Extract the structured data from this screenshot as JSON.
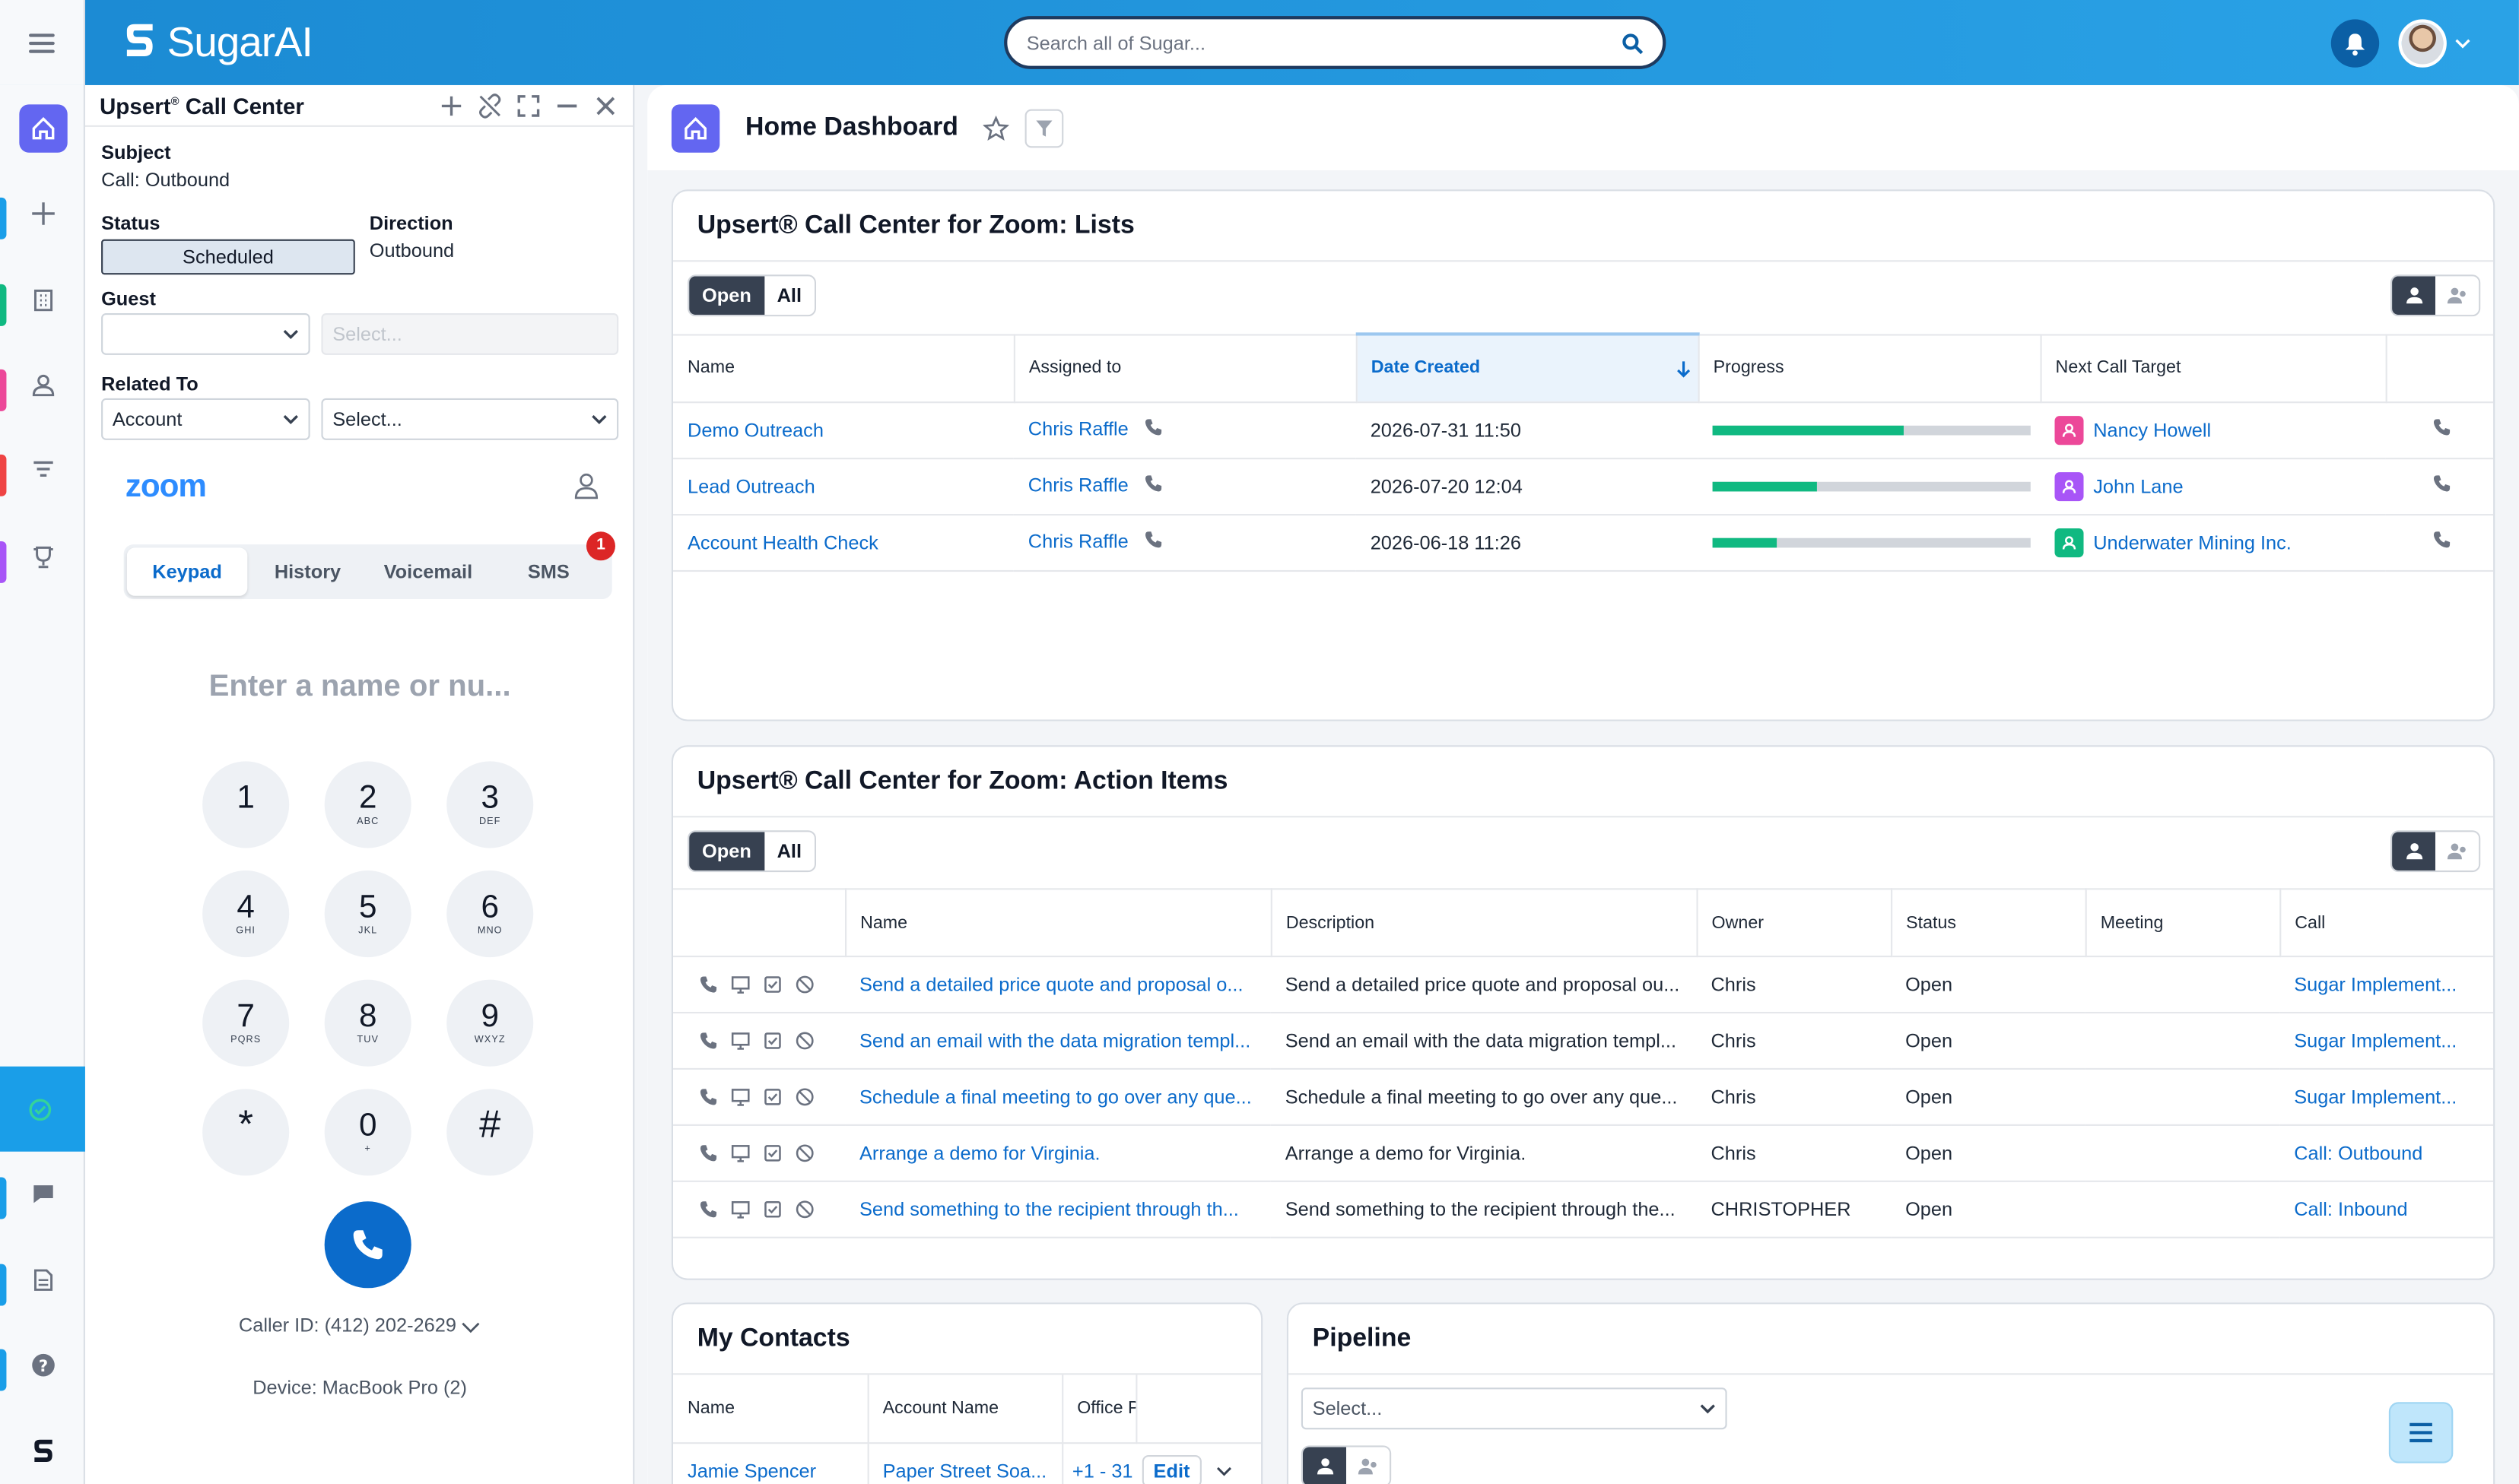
{
  "app": {
    "name": "SugarAI"
  },
  "search": {
    "placeholder": "Search all of Sugar..."
  },
  "call_center": {
    "title": "Upsert",
    "title_sup": "®",
    "title_rest": " Call Center",
    "subject_label": "Subject",
    "subject_value": "Call: Outbound",
    "status_label": "Status",
    "status_value": "Scheduled",
    "direction_label": "Direction",
    "direction_value": "Outbound",
    "guest_label": "Guest",
    "guest_value": "",
    "guest_placeholder": "Select...",
    "related_label": "Related To",
    "related_value": "Account",
    "related_placeholder": "Select...",
    "zoom_logo": "zoom",
    "tabs": [
      "Keypad",
      "History",
      "Voicemail",
      "SMS"
    ],
    "sms_badge": "1",
    "dial_placeholder": "Enter a name or nu...",
    "keys": [
      {
        "d": "1",
        "l": ""
      },
      {
        "d": "2",
        "l": "ABC"
      },
      {
        "d": "3",
        "l": "DEF"
      },
      {
        "d": "4",
        "l": "GHI"
      },
      {
        "d": "5",
        "l": "JKL"
      },
      {
        "d": "6",
        "l": "MNO"
      },
      {
        "d": "7",
        "l": "PQRS"
      },
      {
        "d": "8",
        "l": "TUV"
      },
      {
        "d": "9",
        "l": "WXYZ"
      },
      {
        "d": "*",
        "l": ""
      },
      {
        "d": "0",
        "l": "+"
      },
      {
        "d": "#",
        "l": ""
      }
    ],
    "caller_id": "Caller ID: (412) 202-2629",
    "device": "Device: MacBook Pro (2)"
  },
  "dashboard": {
    "title": "Home Dashboard",
    "lists": {
      "title": "Upsert® Call Center for Zoom: Lists",
      "toggle": [
        "Open",
        "All"
      ],
      "columns": [
        "Name",
        "Assigned to",
        "Date Created",
        "Progress",
        "Next Call Target"
      ],
      "rows": [
        {
          "name": "Demo Outreach",
          "assigned": "Chris Raffle",
          "date": "2026-07-31 11:50",
          "progress": 0.6,
          "target": "Nancy Howell",
          "target_color": "#ec4899"
        },
        {
          "name": "Lead Outreach",
          "assigned": "Chris Raffle",
          "date": "2026-07-20 12:04",
          "progress": 0.33,
          "target": "John Lane",
          "target_color": "#a855f7"
        },
        {
          "name": "Account Health Check",
          "assigned": "Chris Raffle",
          "date": "2026-06-18 11:26",
          "progress": 0.2,
          "target": "Underwater Mining Inc.",
          "target_color": "#10b981"
        }
      ]
    },
    "actions": {
      "title": "Upsert® Call Center for Zoom: Action Items",
      "toggle": [
        "Open",
        "All"
      ],
      "columns": [
        "Name",
        "Description",
        "Owner",
        "Status",
        "Meeting",
        "Call"
      ],
      "rows": [
        {
          "name": "Send a detailed price quote and proposal o...",
          "desc": "Send a detailed price quote and proposal ou...",
          "owner": "Chris",
          "status": "Open",
          "meeting": "",
          "call": "Sugar Implement..."
        },
        {
          "name": "Send an email with the data migration templ...",
          "desc": "Send an email with the data migration templ...",
          "owner": "Chris",
          "status": "Open",
          "meeting": "",
          "call": "Sugar Implement..."
        },
        {
          "name": "Schedule a final meeting to go over any que...",
          "desc": "Schedule a final meeting to go over any que...",
          "owner": "Chris",
          "status": "Open",
          "meeting": "",
          "call": "Sugar Implement..."
        },
        {
          "name": "Arrange a demo for Virginia.",
          "desc": "Arrange a demo for Virginia.",
          "owner": "Chris",
          "status": "Open",
          "meeting": "",
          "call": "Call: Outbound"
        },
        {
          "name": "Send something to the recipient through th...",
          "desc": "Send something to the recipient through the...",
          "owner": "CHRISTOPHER",
          "status": "Open",
          "meeting": "",
          "call": "Call: Inbound"
        }
      ]
    },
    "contacts": {
      "title": "My Contacts",
      "columns": [
        "Name",
        "Account Name",
        "Office P"
      ],
      "rows": [
        {
          "name": "Jamie Spencer",
          "account": "Paper Street Soa...",
          "office": "+1 - 31",
          "edit": "Edit"
        }
      ]
    },
    "pipeline": {
      "title": "Pipeline",
      "select_placeholder": "Select..."
    }
  }
}
